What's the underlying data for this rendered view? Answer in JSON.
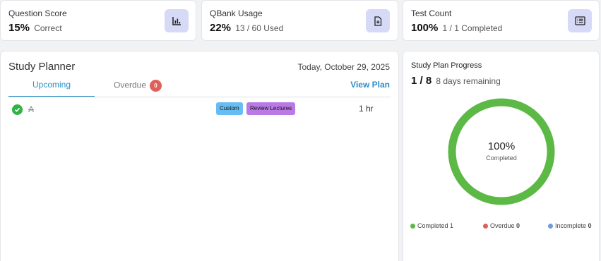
{
  "stats": [
    {
      "label": "Question Score",
      "value": "15%",
      "sub": "Correct",
      "icon": "bar-chart-icon"
    },
    {
      "label": "QBank Usage",
      "value": "22%",
      "sub": "13 / 60 Used",
      "icon": "file-plus-icon"
    },
    {
      "label": "Test Count",
      "value": "100%",
      "sub": "1 / 1 Completed",
      "icon": "list-icon"
    }
  ],
  "planner": {
    "title": "Study Planner",
    "date": "Today, October 29, 2025",
    "tabs": {
      "upcoming": "Upcoming",
      "overdue": "Overdue",
      "overdue_count": "0"
    },
    "view_plan": "View Plan",
    "task": {
      "name": "A",
      "tags": [
        "Custom",
        "Review Lectures"
      ],
      "time": "1 hr"
    }
  },
  "progress": {
    "title": "Study Plan Progress",
    "count": "1 / 8",
    "remaining": "8 days remaining",
    "percent_label": "100%",
    "percent_sub": "Completed",
    "percent_value": 100,
    "legend": [
      {
        "label": "Completed",
        "value": "1",
        "color": "#5cb946"
      },
      {
        "label": "Overdue",
        "value": "0",
        "color": "#df5f5a"
      },
      {
        "label": "Incomplete",
        "value": "0",
        "color": "#6f9ae0"
      }
    ]
  },
  "colors": {
    "accent": "#2a8fc8",
    "ring": "#5cb946",
    "icon_bg": "#d7daf7"
  }
}
